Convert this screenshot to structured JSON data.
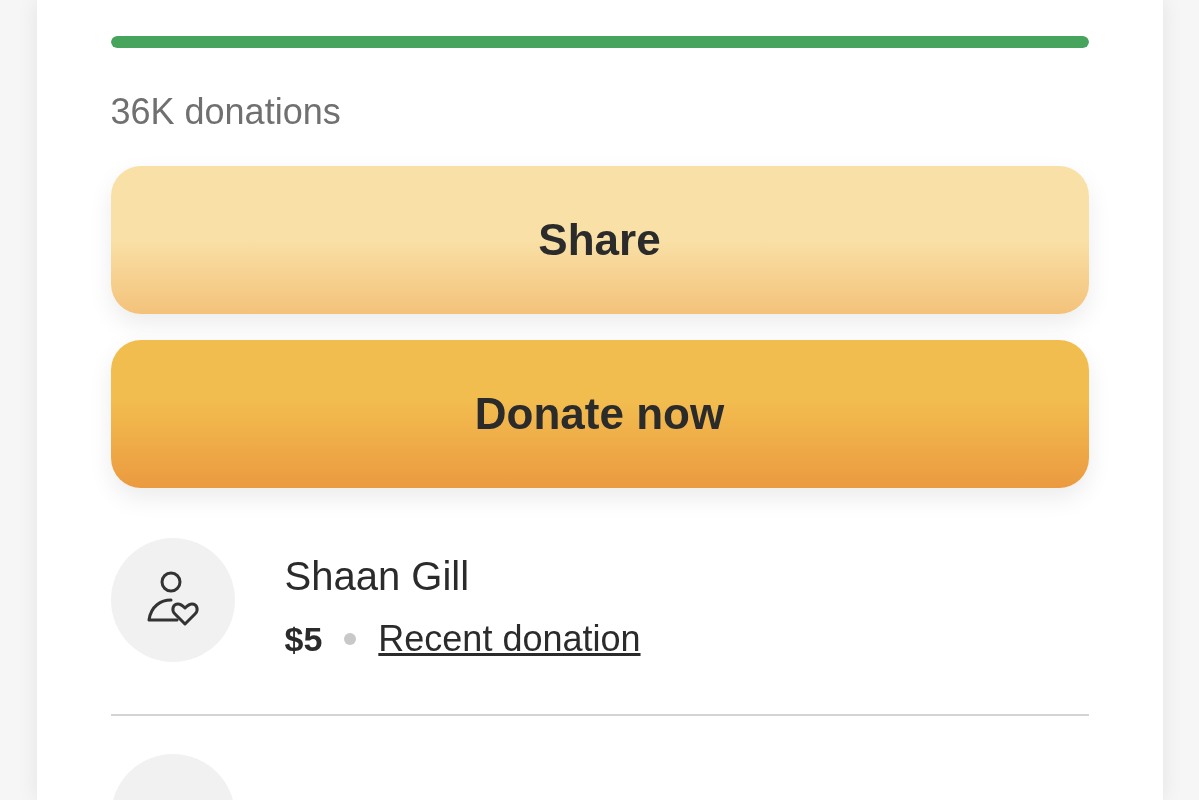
{
  "progress": {
    "level": 1
  },
  "donation_count": "36K donations",
  "buttons": [
    {
      "label": "Share",
      "kind": "secondary"
    },
    {
      "label": "Donate now",
      "kind": "primary"
    }
  ],
  "donors": [
    {
      "name": "Shaan Gill",
      "amount": "$5",
      "note": "Recent donation"
    }
  ]
}
